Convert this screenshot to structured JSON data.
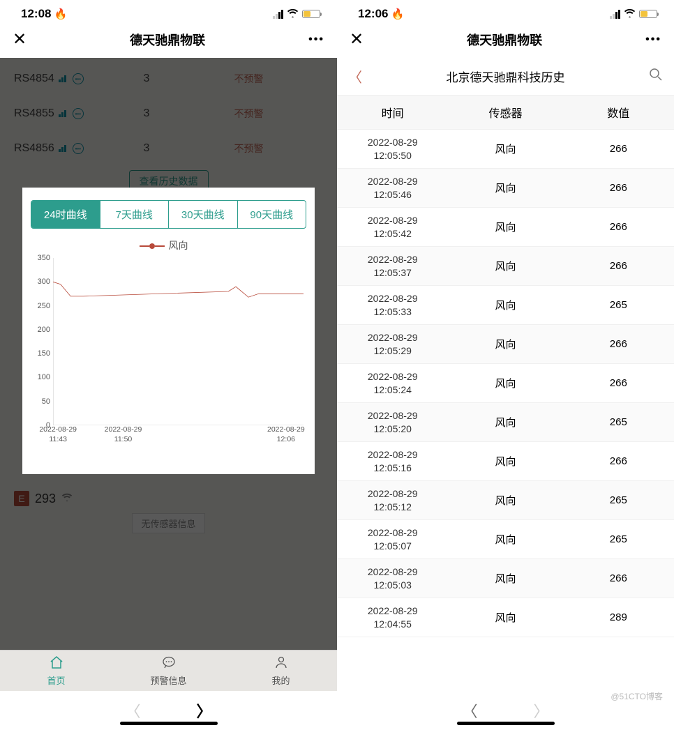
{
  "left": {
    "status_time": "12:08",
    "title": "德天驰鼎物联",
    "sensors": [
      {
        "name": "RS4854",
        "val": "3",
        "warn": "不预警"
      },
      {
        "name": "RS4855",
        "val": "3",
        "warn": "不预警"
      },
      {
        "name": "RS4856",
        "val": "3",
        "warn": "不预警"
      }
    ],
    "history_btn_top": "查看历史数据",
    "history_btn": "查看历史数据",
    "e_badge": "E",
    "e_num": "293",
    "no_sensor": "无传感器信息",
    "tabs": [
      "24时曲线",
      "7天曲线",
      "30天曲线",
      "90天曲线"
    ],
    "active_tab": 0,
    "legend_label": "风向",
    "tabbar": [
      {
        "icon": "⌂",
        "label": "首页"
      },
      {
        "icon": "⊙",
        "label": "预警信息"
      },
      {
        "icon": "☺",
        "label": "我的"
      }
    ]
  },
  "right": {
    "status_time": "12:06",
    "title": "德天驰鼎物联",
    "sub_title": "北京德天驰鼎科技历史",
    "columns": [
      "时间",
      "传感器",
      "数值"
    ],
    "rows": [
      {
        "date": "2022-08-29",
        "time": "12:05:50",
        "sensor": "风向",
        "value": "266"
      },
      {
        "date": "2022-08-29",
        "time": "12:05:46",
        "sensor": "风向",
        "value": "266"
      },
      {
        "date": "2022-08-29",
        "time": "12:05:42",
        "sensor": "风向",
        "value": "266"
      },
      {
        "date": "2022-08-29",
        "time": "12:05:37",
        "sensor": "风向",
        "value": "266"
      },
      {
        "date": "2022-08-29",
        "time": "12:05:33",
        "sensor": "风向",
        "value": "265"
      },
      {
        "date": "2022-08-29",
        "time": "12:05:29",
        "sensor": "风向",
        "value": "266"
      },
      {
        "date": "2022-08-29",
        "time": "12:05:24",
        "sensor": "风向",
        "value": "266"
      },
      {
        "date": "2022-08-29",
        "time": "12:05:20",
        "sensor": "风向",
        "value": "265"
      },
      {
        "date": "2022-08-29",
        "time": "12:05:16",
        "sensor": "风向",
        "value": "266"
      },
      {
        "date": "2022-08-29",
        "time": "12:05:12",
        "sensor": "风向",
        "value": "265"
      },
      {
        "date": "2022-08-29",
        "time": "12:05:07",
        "sensor": "风向",
        "value": "265"
      },
      {
        "date": "2022-08-29",
        "time": "12:05:03",
        "sensor": "风向",
        "value": "266"
      },
      {
        "date": "2022-08-29",
        "time": "12:04:55",
        "sensor": "风向",
        "value": "289"
      }
    ]
  },
  "watermark": "@51CTO博客",
  "colors": {
    "teal": "#2d9d8d",
    "brick": "#b84a3a"
  },
  "chart_data": {
    "type": "line",
    "title": "",
    "legend": [
      "风向"
    ],
    "xlabel": "",
    "ylabel": "",
    "ylim": [
      0,
      350
    ],
    "y_ticks": [
      0,
      50,
      100,
      150,
      200,
      250,
      300,
      350
    ],
    "x_tick_labels": [
      {
        "date": "2022-08-29",
        "time": "11:43"
      },
      {
        "date": "2022-08-29",
        "time": "11:50"
      },
      {
        "date": "2022-08-29",
        "time": "12:06"
      }
    ],
    "series": [
      {
        "name": "风向",
        "x": [
          0,
          0.03,
          0.07,
          0.12,
          0.7,
          0.73,
          0.78,
          0.82,
          1.0
        ],
        "values": [
          300,
          295,
          270,
          270,
          280,
          290,
          268,
          275,
          275
        ]
      }
    ]
  }
}
